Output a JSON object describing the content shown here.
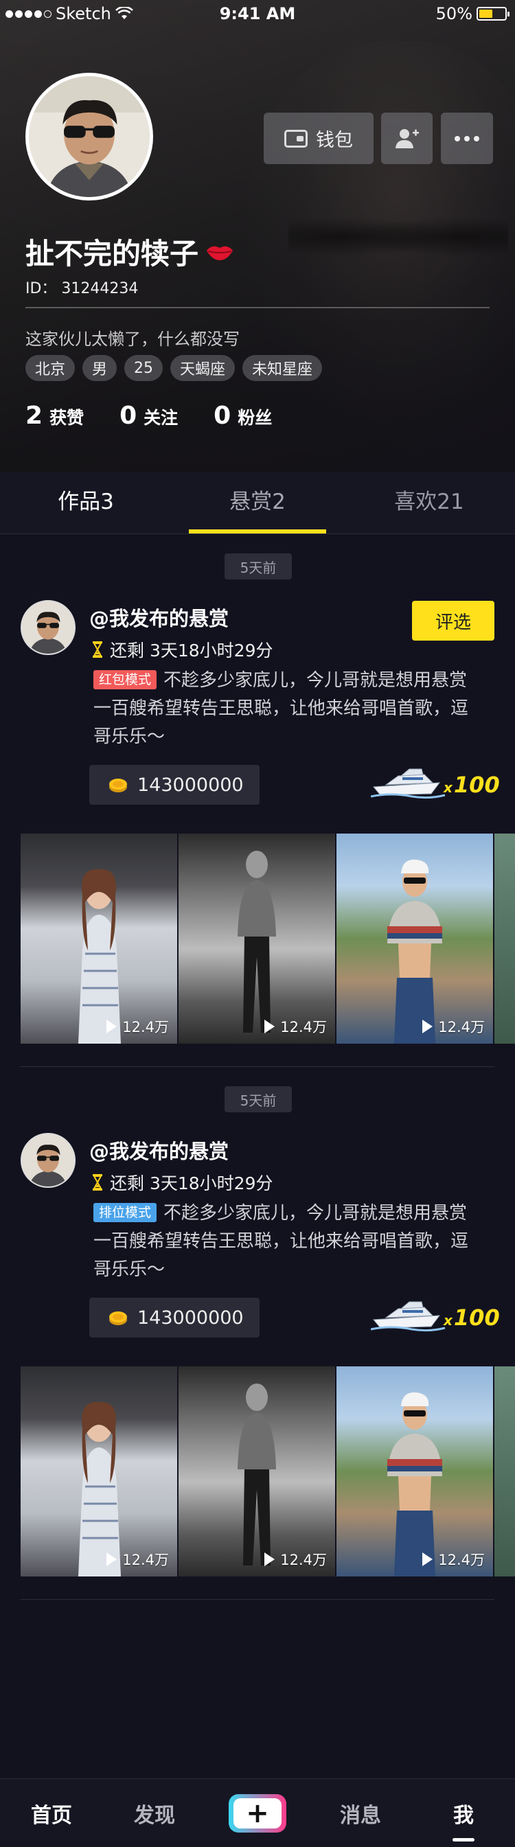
{
  "status_bar": {
    "carrier": "Sketch",
    "time": "9:41 AM",
    "battery": "50%"
  },
  "profile": {
    "wallet_label": "钱包",
    "nickname": "扯不完的犊子",
    "id_text": "ID： 31244234",
    "bio": "这家伙儿太懒了，什么都没写",
    "tags": [
      "北京",
      "男",
      "25",
      "天蝎座",
      "未知星座"
    ],
    "stats": [
      {
        "num": "2",
        "label": "获赞"
      },
      {
        "num": "0",
        "label": "关注"
      },
      {
        "num": "0",
        "label": "粉丝"
      }
    ]
  },
  "tabs": [
    "作品3",
    "悬赏2",
    "喜欢21"
  ],
  "active_tab": "悬赏2",
  "posts": [
    {
      "time_ago": "5天前",
      "title": "@我发布的悬赏",
      "evaluate_label": "评选",
      "remaining": "还剩 3天18小时29分",
      "mode": "红包模式",
      "description": "不趁多少家底儿，今儿哥就是想用悬赏一百艘希望转告王思聪，让他来给哥唱首歌，逗哥乐乐～",
      "coins": "143000000",
      "gift_multiplier": "100",
      "gift_x": "x",
      "plays": [
        "12.4万",
        "12.4万",
        "12.4万"
      ]
    },
    {
      "time_ago": "5天前",
      "title": "@我发布的悬赏",
      "remaining": "还剩 3天18小时29分",
      "mode": "排位模式",
      "description": "不趁多少家底儿，今儿哥就是想用悬赏一百艘希望转告王思聪，让他来给哥唱首歌，逗哥乐乐～",
      "coins": "143000000",
      "gift_multiplier": "100",
      "gift_x": "x",
      "plays": [
        "12.4万",
        "12.4万",
        "12.4万"
      ]
    }
  ],
  "bottom_nav": {
    "home": "首页",
    "discover": "发现",
    "plus": "+",
    "messages": "消息",
    "me": "我"
  },
  "colors": {
    "accent": "#ffe01b",
    "background": "#12121f",
    "mode_red": "#f25a5a",
    "mode_blue": "#4aa3ea"
  }
}
